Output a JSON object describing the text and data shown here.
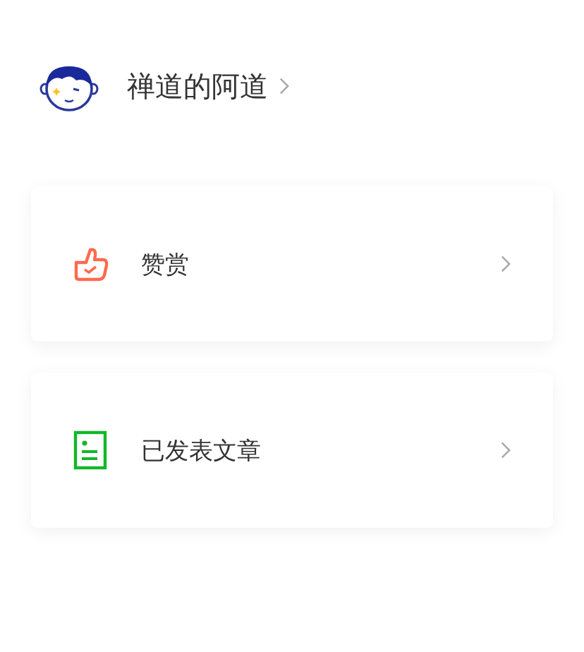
{
  "profile": {
    "name": "禅道的阿道"
  },
  "menu": [
    {
      "kind": "like",
      "label": "赞赏"
    },
    {
      "kind": "article",
      "label": "已发表文章"
    }
  ]
}
